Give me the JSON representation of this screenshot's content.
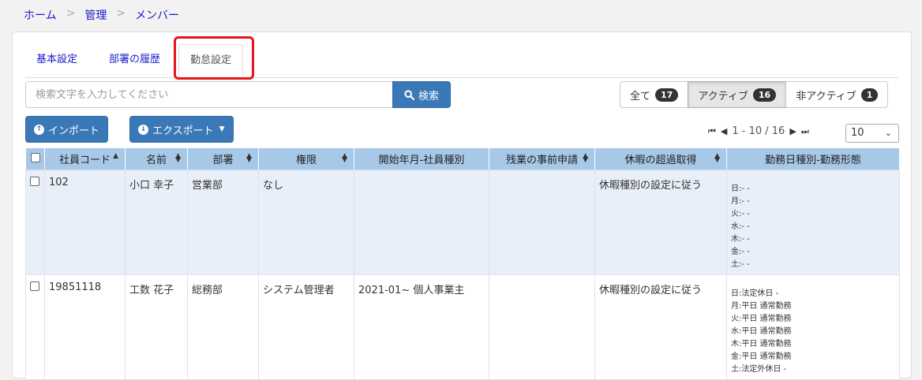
{
  "breadcrumb": [
    "ホーム",
    "管理",
    "メンバー"
  ],
  "breadcrumb_separator": ">",
  "tabs": [
    {
      "label": "基本設定"
    },
    {
      "label": "部署の履歴"
    },
    {
      "label": "勤怠設定",
      "active": true
    }
  ],
  "search": {
    "placeholder": "検索文字を入力してください",
    "value": "",
    "button_label": "検索"
  },
  "filters": [
    {
      "label": "全て",
      "count": "17"
    },
    {
      "label": "アクティブ",
      "count": "16",
      "active": true
    },
    {
      "label": "非アクティブ",
      "count": "1"
    }
  ],
  "actions": {
    "import_label": "インポート",
    "export_label": "エクスポート"
  },
  "pager": {
    "range": "1 - 10 / 16",
    "page_size": "10"
  },
  "table": {
    "headers": [
      "社員コード",
      "名前",
      "部署",
      "権限",
      "開始年月-社員種別",
      "残業の事前申請",
      "休暇の超過取得",
      "勤務日種別-勤務形態"
    ],
    "rows": [
      {
        "code": "102",
        "name": "小口 幸子",
        "dept": "営業部",
        "role": "なし",
        "start": "",
        "overtime": "",
        "leave": "休暇種別の設定に従う",
        "schedule": [
          "日:- -",
          "月:- -",
          "火:- -",
          "水:- -",
          "木:- -",
          "金:- -",
          "土:- -"
        ]
      },
      {
        "code": "19851118",
        "name": "工数 花子",
        "dept": "総務部",
        "role": "システム管理者",
        "start": "2021-01~ 個人事業主",
        "overtime": "",
        "leave": "休暇種別の設定に従う",
        "schedule": [
          "日:法定休日 -",
          "月:平日 通常勤務",
          "火:平日 通常勤務",
          "水:平日 通常勤務",
          "木:平日 通常勤務",
          "金:平日 通常勤務",
          "土:法定外休日 -"
        ]
      }
    ]
  },
  "colors": {
    "link": "#1a1acc",
    "primary_button": "#3a78b8",
    "header_bg": "#a8c8e8",
    "highlight": "#e8141c",
    "admin_text": "#a0473c"
  }
}
